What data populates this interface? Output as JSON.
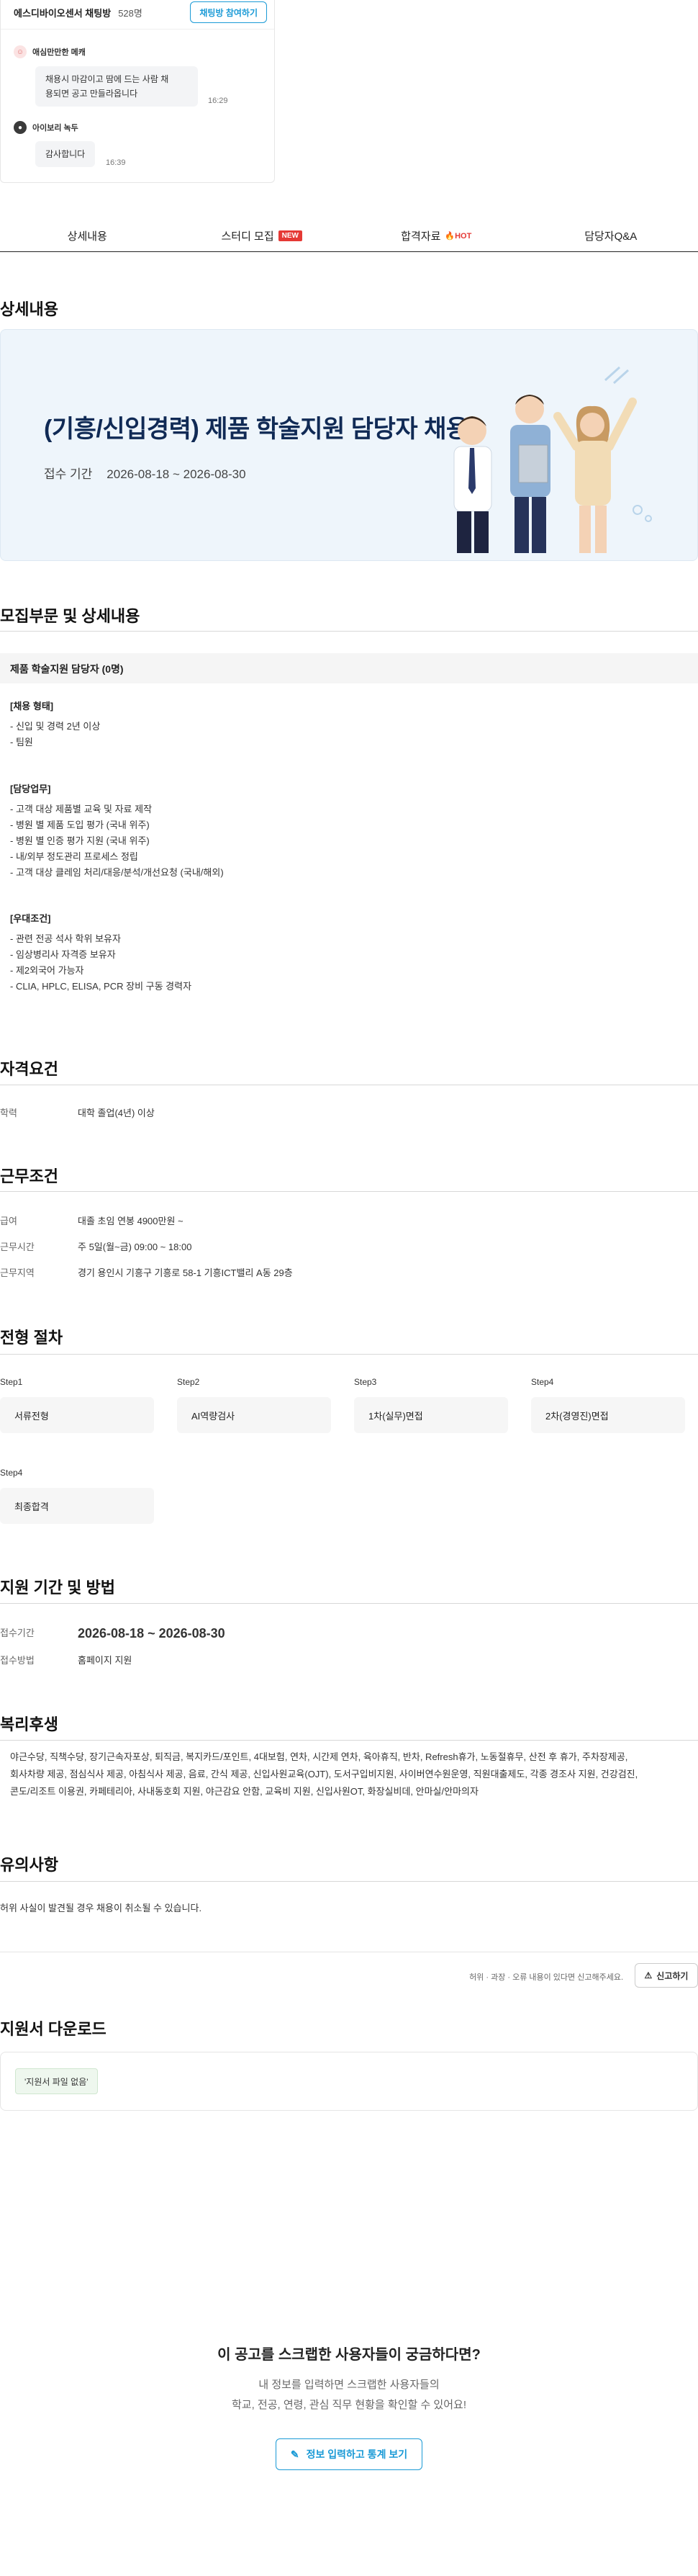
{
  "chat": {
    "title": "에스디바이오센서 채팅방",
    "count": "528명",
    "join_label": "채팅방 참여하기",
    "messages": [
      {
        "user": "애심만만한 메캐",
        "text_line1": "채용시 마감이고 땀에 드는 사람 채",
        "text_line2": "용되면 공고 만들라옵니다",
        "time": "16:29"
      },
      {
        "user": "아이보리 녹두",
        "text_line1": "감사합니다",
        "time": "16:39"
      }
    ]
  },
  "tabs": [
    {
      "label": "상세내용"
    },
    {
      "label": "스터디 모집",
      "badge": "NEW"
    },
    {
      "label": "합격자료",
      "badge": "HOT"
    },
    {
      "label": "담당자Q&A"
    }
  ],
  "detail": {
    "section_title": "상세내용",
    "banner_title": "(기흥/신입경력) 제품 학술지원 담당자 채용",
    "banner_period_label": "접수 기간",
    "banner_period": "2026-08-18 ~ 2026-08-30"
  },
  "recruit": {
    "section_title": "모집부문 및 상세내용",
    "job_heading": "제품 학술지원 담당자 (0명)",
    "blocks": [
      {
        "label": "[채용 형태]",
        "lines": [
          "- 신입 및 경력 2년 이상",
          "- 팀원"
        ]
      },
      {
        "label": "[담당업무]",
        "lines": [
          "- 고객 대상 제품별 교육 및 자료 제작",
          "- 병원 별 제품 도입 평가 (국내 위주)",
          "- 병원 별 인증 평가 지원 (국내 위주)",
          "- 내/외부 정도관리 프로세스 정립",
          "- 고객 대상 클레임 처리/대응/분석/개선요청 (국내/해외)"
        ]
      },
      {
        "label": "[우대조건]",
        "lines": [
          "- 관련 전공 석사 학위 보유자",
          "- 임상병리사 자격증 보유자",
          "- 제2외국어 가능자",
          "- CLIA, HPLC, ELISA, PCR 장비 구동 경력자"
        ]
      }
    ]
  },
  "qualification": {
    "section_title": "자격요건",
    "rows": [
      {
        "k": "학력",
        "v": "대학 졸업(4년) 이상"
      }
    ]
  },
  "conditions": {
    "section_title": "근무조건",
    "rows": [
      {
        "k": "급여",
        "v": "대졸 초임 연봉 4900만원 ~"
      },
      {
        "k": "근무시간",
        "v": "주 5일(월~금) 09:00 ~ 18:00"
      },
      {
        "k": "근무지역",
        "v": "경기 용인시 기흥구 기흥로 58-1 기흥ICT밸리 A동 29층"
      }
    ]
  },
  "process": {
    "section_title": "전형 절차",
    "steps": [
      {
        "label": "Step1",
        "name": "서류전형"
      },
      {
        "label": "Step2",
        "name": "AI역량검사"
      },
      {
        "label": "Step3",
        "name": "1차(실무)면접"
      },
      {
        "label": "Step4",
        "name": "2차(경영진)면접"
      },
      {
        "label": "Step4",
        "name": "최종합격"
      }
    ]
  },
  "apply": {
    "section_title": "지원 기간 및 방법",
    "period_label": "접수기간",
    "period": "2026-08-18 ~ 2026-08-30",
    "method_label": "접수방법",
    "method": "홈페이지 지원"
  },
  "welfare": {
    "section_title": "복리후생",
    "line1": "야근수당, 직책수당, 장기근속자포상, 퇴직금, 복지카드/포인트, 4대보험, 연차, 시간제 연차, 육아휴직, 반차, Refresh휴가, 노동절휴무, 산전 후 휴가, 주차장제공,",
    "line2": "회사차량 제공, 점심식사 제공, 아침식사 제공, 음료, 간식 제공, 신입사원교육(OJT), 도서구입비지원, 사이버연수원운영, 직원대출제도, 각종 경조사 지원, 건강검진,",
    "line3": "콘도/리조트 이용권, 카페테리아, 사내동호회 지원, 야근감요 안함, 교육비 지원, 신입사원OT, 화장실비데, 안마실/안마의자"
  },
  "notice": {
    "section_title": "유의사항",
    "text": "허위 사실이 발견될 경우 채용이 취소될 수 있습니다."
  },
  "report": {
    "text": "허위 · 과장 · 오류 내용이 있다면 신고해주세요.",
    "button": "신고하기"
  },
  "download": {
    "section_title": "지원서 다운로드",
    "tag": "'지원서 파일 없음'"
  },
  "cta": {
    "title": "이 공고를 스크랩한 사용자들이 궁금하다면?",
    "sub1": "내 정보를 입력하면 스크랩한 사용자들의",
    "sub2": "학교, 전공, 연령, 관심 직무 현황을 확인할 수 있어요!",
    "button": "정보 입력하고 통계 보기"
  },
  "colors": {
    "accent": "#1a9ad6",
    "hot": "#e53935",
    "banner_title": "#102a55"
  }
}
